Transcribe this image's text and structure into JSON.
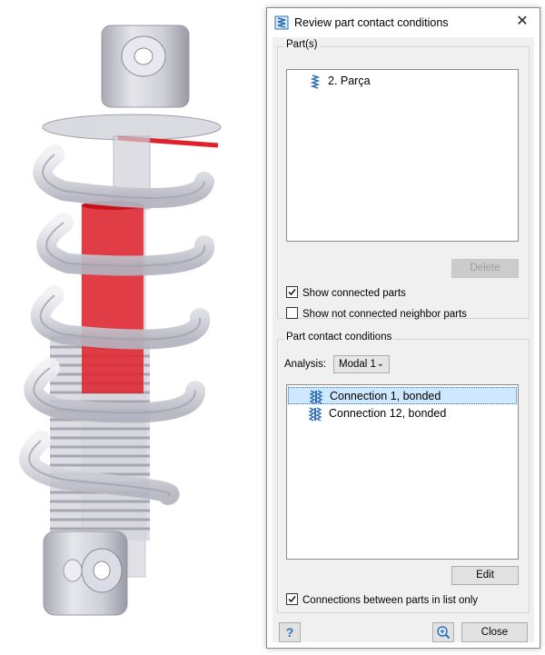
{
  "dialog": {
    "title": "Review part contact conditions",
    "close_glyph": "✕"
  },
  "parts_group": {
    "label": "Part(s)",
    "items": [
      {
        "label": "2. Parça",
        "icon": "spring-part-icon"
      }
    ],
    "delete_label": "Delete",
    "show_connected": {
      "label": "Show connected parts",
      "checked": true
    },
    "show_not_connected": {
      "label": "Show not connected neighbor parts",
      "checked": false
    }
  },
  "contact_group": {
    "label": "Part contact conditions",
    "analysis_label": "Analysis:",
    "analysis_value": "Modal 1",
    "connections": [
      {
        "label": "Connection 1, bonded",
        "selected": true,
        "icon": "bonded-connection-icon"
      },
      {
        "label": "Connection 12, bonded",
        "selected": false,
        "icon": "bonded-connection-icon"
      }
    ],
    "edit_label": "Edit",
    "list_only": {
      "label": "Connections between parts in list only",
      "checked": true
    }
  },
  "footer": {
    "help_glyph": "?",
    "close_label": "Close"
  },
  "colors": {
    "highlight_red": "#e0202a",
    "selection_bg": "#cde8ff",
    "accent_blue": "#2f6fb5"
  }
}
